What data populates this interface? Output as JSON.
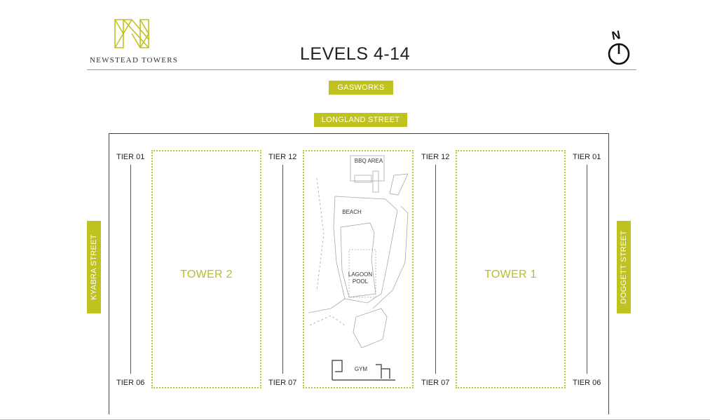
{
  "brand": {
    "name": "NEWSTEAD TOWERS",
    "logo_icon": "triangle-lattice-n-logo",
    "accent_color": "#bfc21f"
  },
  "page_title": "LEVELS 4-14",
  "compass": {
    "label": "N",
    "icon": "north-compass-icon"
  },
  "streets": {
    "top_outer": "GASWORKS",
    "top_inner": "LONGLAND STREET",
    "left": "KYABRA STREET",
    "right": "DOGGETT STREET"
  },
  "towers": {
    "left": "TOWER 2",
    "right": "TOWER 1"
  },
  "tiers": {
    "far_left_top": "TIER 01",
    "far_left_bottom": "TIER 06",
    "mid_left_top": "TIER 12",
    "mid_left_bottom": "TIER 07",
    "mid_right_top": "TIER 12",
    "mid_right_bottom": "TIER 07",
    "far_right_top": "TIER 01",
    "far_right_bottom": "TIER 06"
  },
  "amenities": {
    "bbq": "BBQ AREA",
    "beach": "BEACH",
    "pool_line1": "LAGOON",
    "pool_line2": "POOL",
    "gym": "GYM"
  }
}
